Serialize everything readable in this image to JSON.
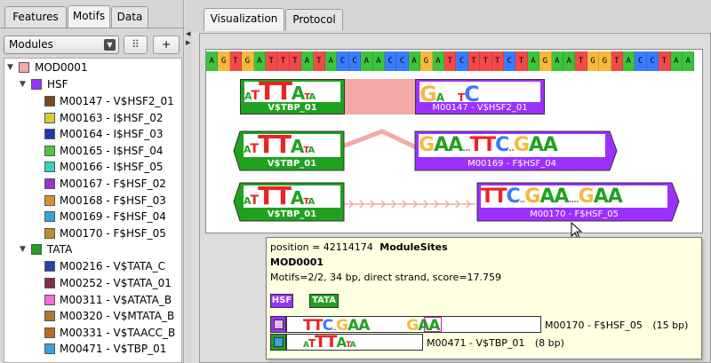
{
  "left_tabs": [
    "Features",
    "Motifs",
    "Data"
  ],
  "right_tabs": [
    "Visualization",
    "Protocol"
  ],
  "modules_select": {
    "value": "Modules"
  },
  "buttons": {
    "add_label": "+"
  },
  "tree": {
    "root": {
      "label": "MOD0001",
      "color": "#f4a8a8"
    },
    "groups": [
      {
        "label": "HSF",
        "color": "#9b30ff",
        "items": [
          {
            "label": "M00147 - V$HSF2_01",
            "color": "#7b4a1e"
          },
          {
            "label": "M00163 - I$HSF_02",
            "color": "#d7cf30"
          },
          {
            "label": "M00164 - I$HSF_03",
            "color": "#2434b8"
          },
          {
            "label": "M00165 - I$HSF_04",
            "color": "#4fc93a"
          },
          {
            "label": "M00166 - I$HSF_05",
            "color": "#37d3c0"
          },
          {
            "label": "M00167 - F$HSF_02",
            "color": "#9a35c8"
          },
          {
            "label": "M00168 - F$HSF_03",
            "color": "#e28a33"
          },
          {
            "label": "M00169 - F$HSF_04",
            "color": "#3aa0e6"
          },
          {
            "label": "M00170 - F$HSF_05",
            "color": "#c38a2e"
          }
        ]
      },
      {
        "label": "TATA",
        "color": "#22a022",
        "items": [
          {
            "label": "M00216 - V$TATA_C",
            "color": "#2a3fb0"
          },
          {
            "label": "M00252 - V$TATA_01",
            "color": "#8c2a4a"
          },
          {
            "label": "M00311 - V$ATATA_B",
            "color": "#f06ae0"
          },
          {
            "label": "M00320 - V$MTATA_B",
            "color": "#b07a2a"
          },
          {
            "label": "M00331 - V$TAACC_B",
            "color": "#c06a1a"
          },
          {
            "label": "M00471 - V$TBP_01",
            "color": "#3aa0e6"
          }
        ]
      }
    ]
  },
  "sequence": [
    "A",
    "G",
    "T",
    "G",
    "A",
    "T",
    "T",
    "T",
    "A",
    "T",
    "A",
    "C",
    "C",
    "A",
    "A",
    "C",
    "C",
    "A",
    "G",
    "A",
    "T",
    "C",
    "T",
    "T",
    "T",
    "C",
    "T",
    "A",
    "G",
    "A",
    "A",
    "T",
    "G",
    "G",
    "T",
    "A",
    "C",
    "C",
    "T",
    "A",
    "A"
  ],
  "nucleotide_colors": {
    "A": "#3cc43c",
    "C": "#3a7bff",
    "G": "#f6b93b",
    "T": "#f24a4a"
  },
  "sites": [
    {
      "name": "V$TBP_01",
      "group": "TATA"
    },
    {
      "name": "M00147 - V$HSF2_01",
      "group": "HSF"
    },
    {
      "name": "V$TBP_01",
      "group": "TATA"
    },
    {
      "name": "M00169 - F$HSF_04",
      "group": "HSF"
    },
    {
      "name": "V$TBP_01",
      "group": "TATA"
    },
    {
      "name": "M00170 - F$HSF_05",
      "group": "HSF"
    }
  ],
  "logos": {
    "tbp": "ATTATA",
    "hsf2": "GA TC",
    "hsf4": "GAA TTC GAA",
    "hsf5": "TTC GAA GAA"
  },
  "colors": {
    "tata_green": "#1fa21f",
    "hsf_purple": "#9b30ff",
    "module_pink": "#f4a8a8"
  },
  "tooltip": {
    "position": "position = 42114174",
    "type": "ModuleSites",
    "module": "MOD0001",
    "details": "Motifs=2/2, 34 bp, direct strand, score=17.759",
    "chips": [
      "HSF",
      "TATA"
    ],
    "rows": [
      {
        "name": "M00170 - F$HSF_05",
        "length": "(15 bp)"
      },
      {
        "name": "M00471 - V$TBP_01",
        "length": "(8 bp)"
      }
    ]
  }
}
